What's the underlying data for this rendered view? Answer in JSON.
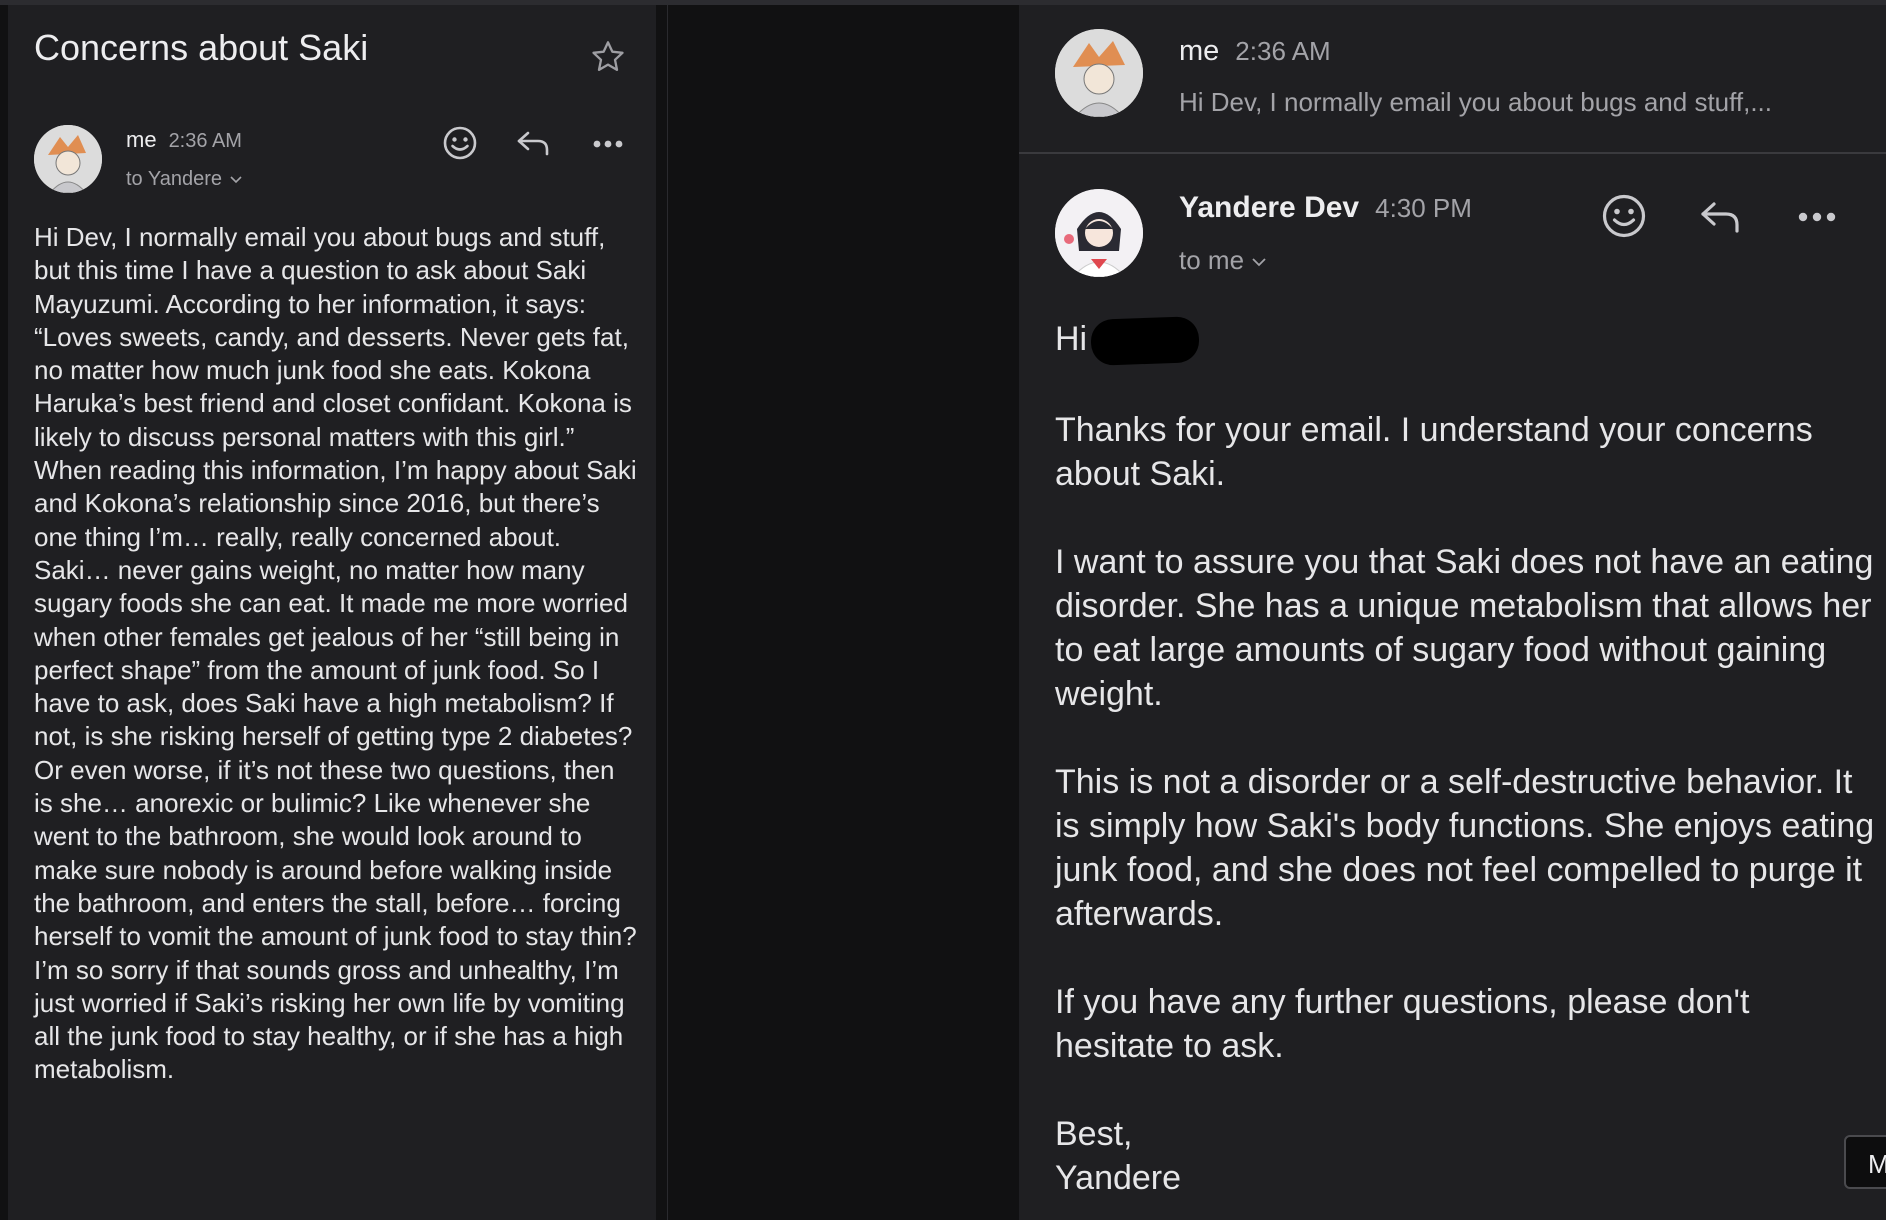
{
  "thread": {
    "subject": "Concerns about Saki"
  },
  "left_message": {
    "sender": "me",
    "time": "2:36 AM",
    "to_label": "to Yandere",
    "paragraphs": [
      "Hi Dev, I normally email you about bugs and stuff, but this time I have a question to ask about Saki Mayuzumi. According to her information, it says:",
      "“Loves sweets, candy, and desserts. Never gets fat, no matter how much junk food she eats. Kokona Haruka’s best friend and closet confidant. Kokona is likely to discuss personal matters with this girl.”",
      "When reading this information, I’m happy about Saki and Kokona’s relationship since 2016, but there’s one thing I’m… really, really concerned about. Saki… never gains weight, no matter how many sugary foods she can eat. It made me more worried when other females get jealous of her “still being in perfect shape” from the amount of junk food. So I have to ask, does Saki have a high metabolism? If not, is she risking herself of getting type 2 diabetes? Or even worse, if it’s not these two questions, then is she… anorexic or bulimic? Like whenever she went to the bathroom, she would look around to make sure nobody is around before walking inside the bathroom, and enters the stall, before… forcing herself to vomit the amount of junk food to stay thin? I’m so sorry if that sounds gross and unhealthy, I’m just worried if Saki’s risking her own life by vomiting all the junk food to stay healthy, or if she has a high metabolism."
    ]
  },
  "collapsed_message": {
    "sender": "me",
    "time": "2:36 AM",
    "snippet": "Hi Dev, I normally email you about bugs and stuff,..."
  },
  "reply_message": {
    "sender": "Yandere Dev",
    "time": "4:30 PM",
    "to_label": "to me",
    "greeting": "Hi",
    "paragraphs": [
      "Thanks for your email. I understand your concerns about Saki.",
      "I want to assure you that Saki does not have an eating disorder. She has a unique metabolism that allows her to eat large amounts of sugary food without gaining weight.",
      "This is not a disorder or a self-destructive behavior. It is simply how Saki's body functions. She enjoys eating junk food, and she does not feel compelled to purge it afterwards.",
      "If you have any further questions, please don't hesitate to ask."
    ],
    "signoff": "Best,",
    "signature": "Yandere"
  },
  "edge_tab": {
    "label": "M"
  },
  "icons": [
    "star-icon",
    "emoji-reaction-icon",
    "reply-icon",
    "more-options-icon",
    "chevron-down-icon",
    "avatar"
  ],
  "colors": {
    "panel_bg": "#1f1f22",
    "page_bg": "#111112",
    "text_primary": "#ededef",
    "text_secondary": "#a3a3a8"
  }
}
